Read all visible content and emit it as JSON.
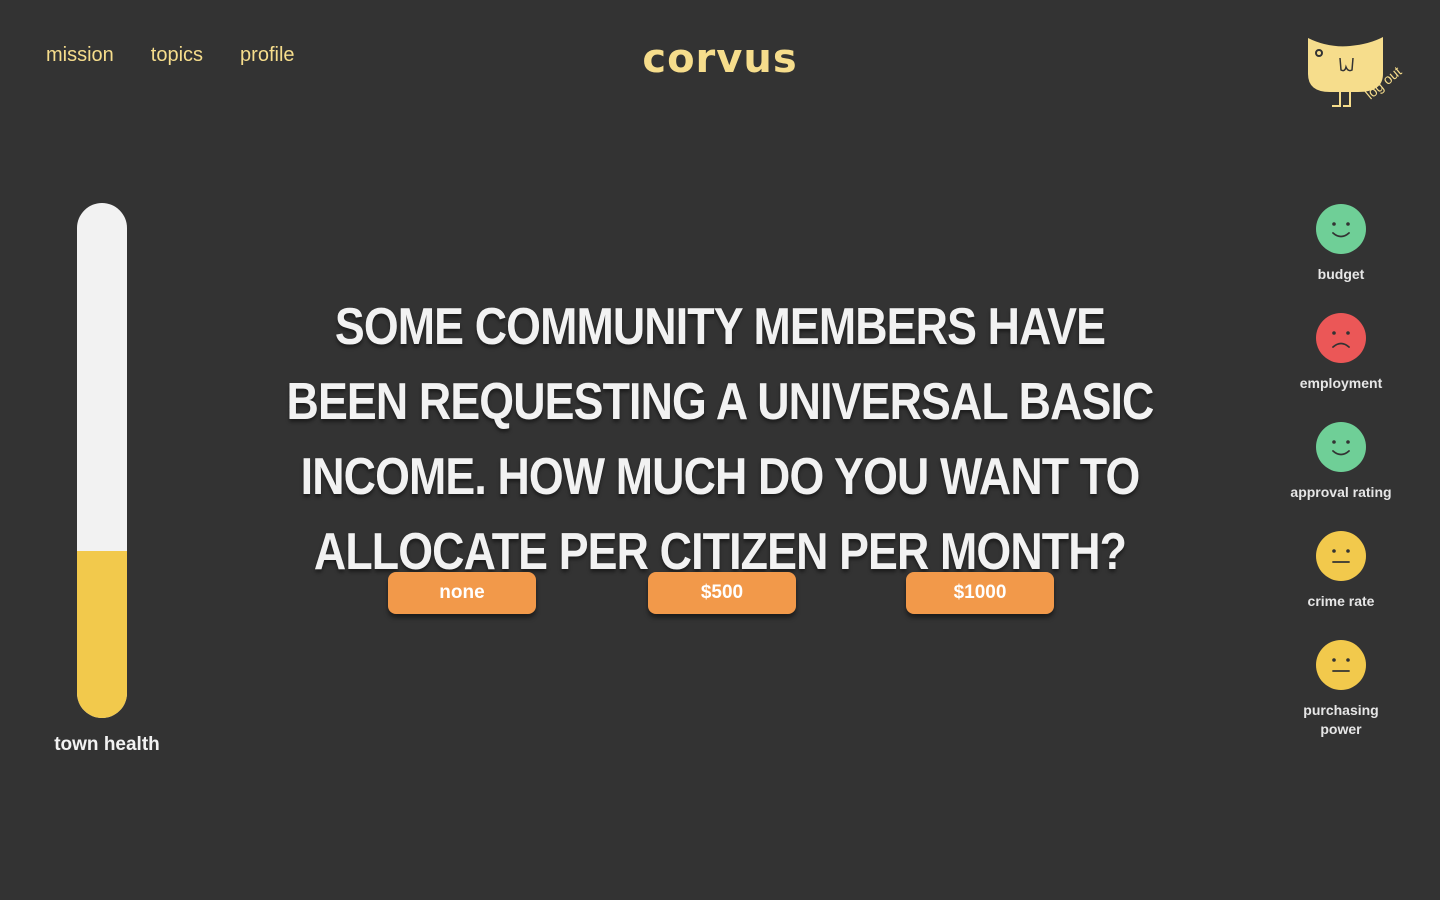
{
  "nav": {
    "items": [
      {
        "label": "mission"
      },
      {
        "label": "topics"
      },
      {
        "label": "profile"
      }
    ]
  },
  "brand": {
    "name": "corvus"
  },
  "account": {
    "logout_label": "log out"
  },
  "town_health": {
    "label": "town health",
    "level_fraction": 0.325,
    "fill_color": "#f2c94c",
    "track_color": "#f2f2f2"
  },
  "question": {
    "text": "Some community members have been requesting a universal basic income. How much do you want to allocate per citizen per month?"
  },
  "options": [
    {
      "label": "none"
    },
    {
      "label": "$500"
    },
    {
      "label": "$1000"
    }
  ],
  "indicators": [
    {
      "label": "budget",
      "mood": "happy",
      "color": "#6fcf97",
      "icon": "happy-face-icon"
    },
    {
      "label": "employment",
      "mood": "sad",
      "color": "#eb5757",
      "icon": "sad-face-icon"
    },
    {
      "label": "approval rating",
      "mood": "happy",
      "color": "#6fcf97",
      "icon": "happy-face-icon"
    },
    {
      "label": "crime rate",
      "mood": "neutral",
      "color": "#f2c94c",
      "icon": "neutral-face-icon"
    },
    {
      "label": "purchasing power",
      "mood": "neutral",
      "color": "#f2c94c",
      "icon": "neutral-face-icon"
    }
  ],
  "colors": {
    "background": "#333333",
    "accent_yellow": "#f6dd8c",
    "button_orange": "#f2994a"
  }
}
